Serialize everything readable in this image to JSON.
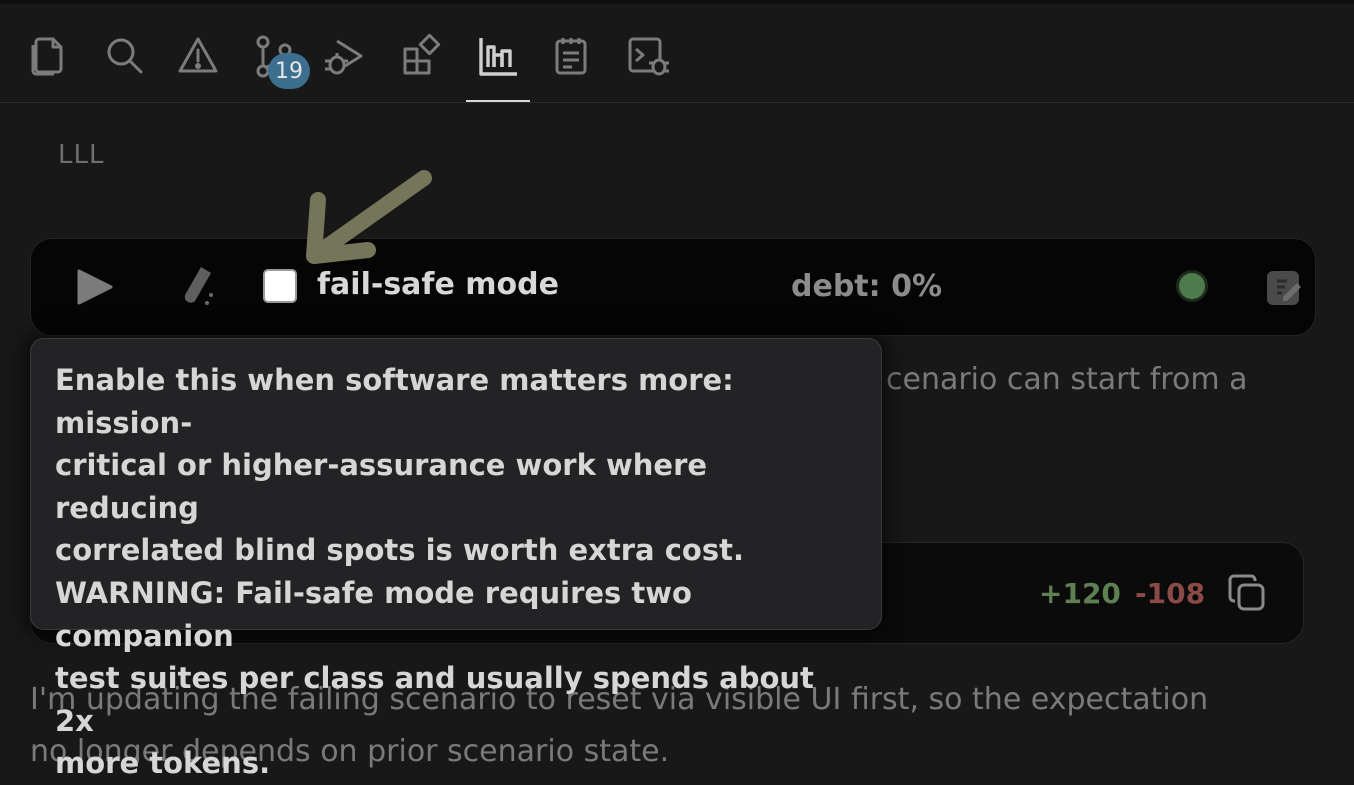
{
  "activity_bar": {
    "icons": [
      "files-icon",
      "search-icon",
      "warning-icon",
      "source-control-icon",
      "run-debug-icon",
      "extensions-icon",
      "chart-icon",
      "notes-icon",
      "terminal-debug-icon"
    ],
    "source_control_badge": "19"
  },
  "panel": {
    "section_title": "LLL"
  },
  "toolbar": {
    "checkbox_label": "fail-safe mode",
    "checkbox_checked": false,
    "debt": "debt: 0%",
    "status_color": "#4f7a4d"
  },
  "tooltip": {
    "text": "Enable this when software matters more: mission-\ncritical or higher-assurance work where reducing\ncorrelated blind spots is worth extra cost.\nWARNING: Fail-safe mode requires two companion\ntest suites per class and usually spends about 2x\nmore tokens."
  },
  "background": {
    "partial_line": "cenario can start from a"
  },
  "diff": {
    "added": "+120",
    "removed": "-108"
  },
  "message": {
    "line1": "I'm updating the failing scenario to reset via visible UI first, so the expectation",
    "line2": "no longer depends on prior scenario state."
  },
  "colors": {
    "accent_arrow": "#7a7a5c",
    "added": "#5d7f52",
    "removed": "#8a4a45",
    "badge": "#3c6e8f"
  }
}
